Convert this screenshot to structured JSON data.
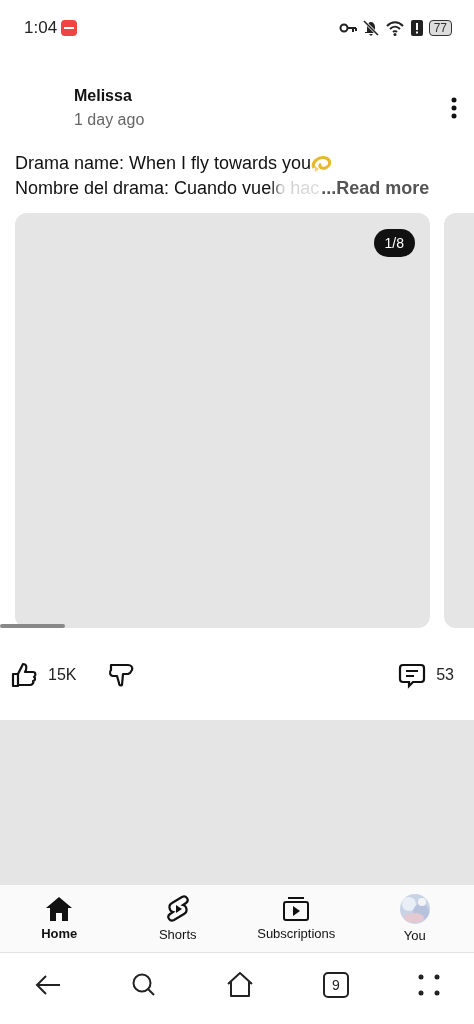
{
  "status_bar": {
    "time": "1:04",
    "battery": "77"
  },
  "post": {
    "author": "Melissa",
    "time": "1 day ago",
    "lines": [
      "Drama name: When I fly towards you",
      "Nombre del drama: Cuando vuelo hac"
    ],
    "read_more": "...Read more",
    "image_counter": "1/8",
    "likes": "15K",
    "comments": "53"
  },
  "nav_tabs": [
    {
      "label": "Home",
      "selected": true,
      "kind": "home"
    },
    {
      "label": "Shorts",
      "selected": false,
      "kind": "shorts"
    },
    {
      "label": "Subscriptions",
      "selected": false,
      "kind": "subscriptions"
    },
    {
      "label": "You",
      "selected": false,
      "kind": "avatar"
    }
  ],
  "system_nav": {
    "tab_count": "9"
  }
}
